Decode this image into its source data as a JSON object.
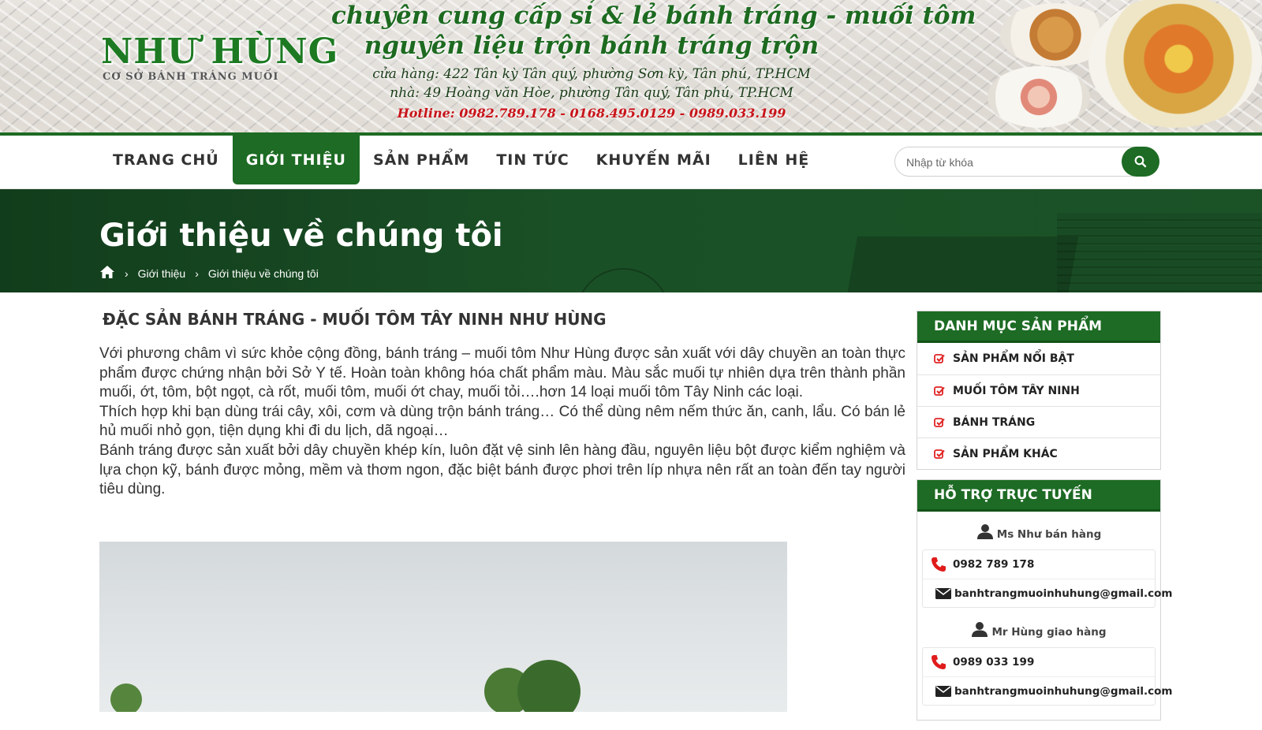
{
  "banner": {
    "brand_name": "NHƯ HÙNG",
    "brand_sub": "CƠ SỞ BÁNH TRÁNG MUỐI",
    "slogan_line1": "chuyên cung cấp sỉ & lẻ bánh tráng - muối tôm",
    "slogan_line2": "nguyên liệu trộn bánh tráng trộn",
    "address_store": "cửa hàng: 422 Tân kỳ Tân quý, phường Sơn kỳ, Tân phú, TP.HCM",
    "address_home": "nhà: 49 Hoàng văn Hòe, phường Tân quý, Tân phú, TP.HCM",
    "hotline": "Hotline: 0982.789.178 - 0168.495.0129 - 0989.033.199"
  },
  "nav": {
    "items": [
      {
        "label": "TRANG CHỦ"
      },
      {
        "label": "GIỚI THIỆU"
      },
      {
        "label": "SẢN PHẨM"
      },
      {
        "label": "TIN TỨC"
      },
      {
        "label": "KHUYẾN MÃI"
      },
      {
        "label": "LIÊN HỆ"
      }
    ],
    "active_index": 1,
    "search_placeholder": "Nhập từ khóa",
    "search_value": ""
  },
  "page": {
    "title": "Giới thiệu về chúng tôi",
    "breadcrumb": [
      "Giới thiệu",
      "Giới thiệu về chúng tôi"
    ]
  },
  "article": {
    "heading": "ĐẶC SẢN BÁNH TRÁNG - MUỐI TÔM TÂY NINH NHƯ HÙNG",
    "paragraphs": [
      "Với phương châm vì sức khỏe cộng đồng, bánh tráng – muối tôm Như Hùng được sản xuất với dây chuyền an toàn thực phẩm được chứng nhận bởi Sở Y tế. Hoàn toàn không hóa chất phẩm màu. Màu sắc muối tự nhiên dựa trên thành phần muối, ớt, tôm, bột ngọt, cà rốt, muối tôm, muối ớt chay, muối tỏi….hơn 14 loại muối tôm Tây Ninh các loại.",
      "Thích hợp khi bạn dùng trái cây, xôi, cơm và dùng trộn bánh tráng… Có thể dùng nêm nếm thức ăn, canh, lẩu. Có bán lẻ hủ muối nhỏ gọn, tiện dụng khi đi du lịch, dã ngoại…",
      "Bánh tráng được sản xuất bởi dây chuyền khép kín, luôn đặt vệ sinh lên hàng đầu, nguyên liệu bột được kiểm nghiệm và lựa chọn kỹ, bánh được mỏng, mềm và thơm ngon, đặc biệt bánh được phơi trên líp nhựa nên rất an toàn đến tay người tiêu dùng."
    ]
  },
  "sidebar": {
    "categories_title": "DANH MỤC SẢN PHẨM",
    "categories": [
      {
        "label": "SẢN PHẨM NỔI BẬT"
      },
      {
        "label": "MUỐI TÔM TÂY NINH"
      },
      {
        "label": "BÁNH TRÁNG"
      },
      {
        "label": "SẢN PHẨM KHÁC"
      }
    ],
    "support_title": "HỖ TRỢ TRỰC TUYẾN",
    "contacts": [
      {
        "name": "Ms Như bán hàng",
        "phone": "0982 789 178",
        "email": "banhtrangmuoinhuhung@gmail.com"
      },
      {
        "name": "Mr Hùng giao hàng",
        "phone": "0989 033 199",
        "email": "banhtrangmuoinhuhung@gmail.com"
      }
    ]
  },
  "colors": {
    "primary_green": "#1d6b24",
    "hotline_red": "#c8141a",
    "text": "#333333"
  }
}
